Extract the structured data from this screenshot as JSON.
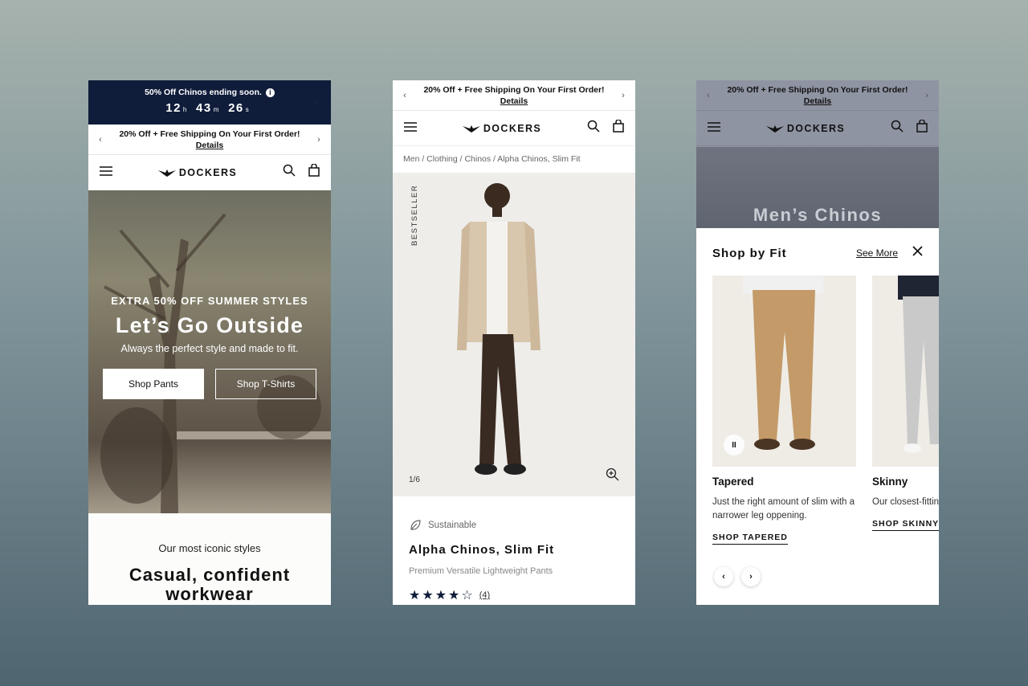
{
  "brand": {
    "name": "DOCKERS"
  },
  "countdown": {
    "text": "50% Off Chinos ending soon.",
    "hours": "12",
    "minutes": "43",
    "seconds": "26",
    "h": "h",
    "m": "m",
    "s": "s"
  },
  "promo": {
    "text": "20% Off + Free Shipping On Your First Order!",
    "details": "Details"
  },
  "icons": {
    "close": "✕",
    "info": "i",
    "prev": "‹",
    "next": "›"
  },
  "home": {
    "hero_sub": "EXTRA 50% OFF SUMMER STYLES",
    "hero_title": "Let’s Go Outside",
    "hero_desc": "Always the perfect style and made to fit.",
    "btn_pants": "Shop Pants",
    "btn_tshirts": "Shop T-Shirts",
    "iconic_small": "Our most iconic styles",
    "iconic_big": "Casual, confident workwear"
  },
  "product": {
    "breadcrumb": "Men / Clothing / Chinos / Alpha Chinos, Slim Fit",
    "badge": "BESTSELLER",
    "image_counter": "1/6",
    "sustainable": "Sustainable",
    "title": "Alpha Chinos, Slim Fit",
    "subtitle": "Premium Versatile Lightweight Pants",
    "rating": 4,
    "review_count": "(4)"
  },
  "category": {
    "hero_title": "Men’s Chinos",
    "drawer_title": "Shop by Fit",
    "see_more": "See More",
    "cards": [
      {
        "name": "Tapered",
        "desc": "Just the right amount of slim with a narrower leg oppening.",
        "cta": "SHOP TAPERED",
        "color": "#c39a68"
      },
      {
        "name": "Skinny",
        "desc": "Our closest-fitting",
        "cta": "SHOP SKINNY",
        "color": "#c9c9c9"
      }
    ],
    "pause": "II"
  },
  "colors": {
    "navy": "#0f1c3a",
    "khaki": "#c39a68"
  }
}
